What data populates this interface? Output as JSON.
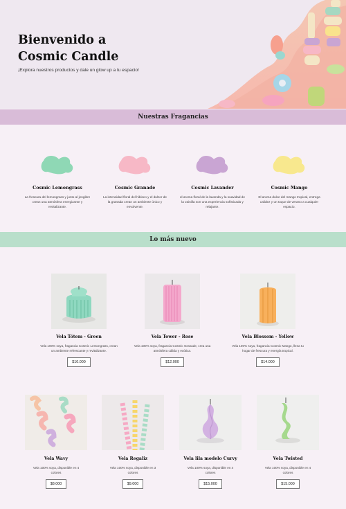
{
  "hero": {
    "title_line1": "Bienvenido a",
    "title_line2": "Cosmic Candle",
    "subtitle": "¡Explora nuestros productos y dale un glow up a tu espacio!"
  },
  "fragrances": {
    "heading": "Nuestras Fragancias",
    "items": [
      {
        "name": "Cosmic Lemongrass",
        "desc": "La frescura del lemongrass y junto al jengibre crean una atmósfera energizante y revitalizante.",
        "color": "#8fd8b5"
      },
      {
        "name": "Cosmic Granade",
        "desc": "La intensidad floral del hibisco y el dulzor de la granada crean un ambiente único y envolvente.",
        "color": "#f7b8c6"
      },
      {
        "name": "Cosmic Lavander",
        "desc": "el aroma floral de la lavanda y la suavidad de la vainilla son una experiencia sofisticada y relajante.",
        "color": "#c9a5d3"
      },
      {
        "name": "Cosmic Mango",
        "desc": "El aroma dulce del mango tropical, entrega calidez y un toque de verano a cualquier espacio.",
        "color": "#f8e88e"
      }
    ]
  },
  "new": {
    "heading": "Lo más nuevo",
    "row1": [
      {
        "name": "Vela Tótem - Green",
        "desc": "Vela 100% soya, fragancia Cosmic Lemongrass, crean un ambiente refrescante y revitalizante.",
        "price": "$10.000"
      },
      {
        "name": "Vela Tower - Rose",
        "desc": "Vela 100% soya, fragancia Cosmic Granade, crea una atmósfera cálida y exótica.",
        "price": "$12.000"
      },
      {
        "name": "Vela Blossom - Yellow",
        "desc": "Vela 100% soya, fragancia Cosmic Mango, llena tu hogar de frescura y energía tropical.",
        "price": "$14.000"
      }
    ],
    "row2": [
      {
        "name": "Vela Wavy",
        "desc": "Vela 100% soya, disponible en 4 colores",
        "price": "$8.000"
      },
      {
        "name": "Vela Regaliz",
        "desc": "Vela 100% soya, disponible en 3 colores",
        "price": "$9.000"
      },
      {
        "name": "Vela lila modelo Curvy",
        "desc": "Vela 100% soya, disponible en 4 colores",
        "price": "$15.000"
      },
      {
        "name": "Vela Twisted",
        "desc": "Vela 100% soya, disponible en 4 colores",
        "price": "$15.000"
      }
    ]
  }
}
